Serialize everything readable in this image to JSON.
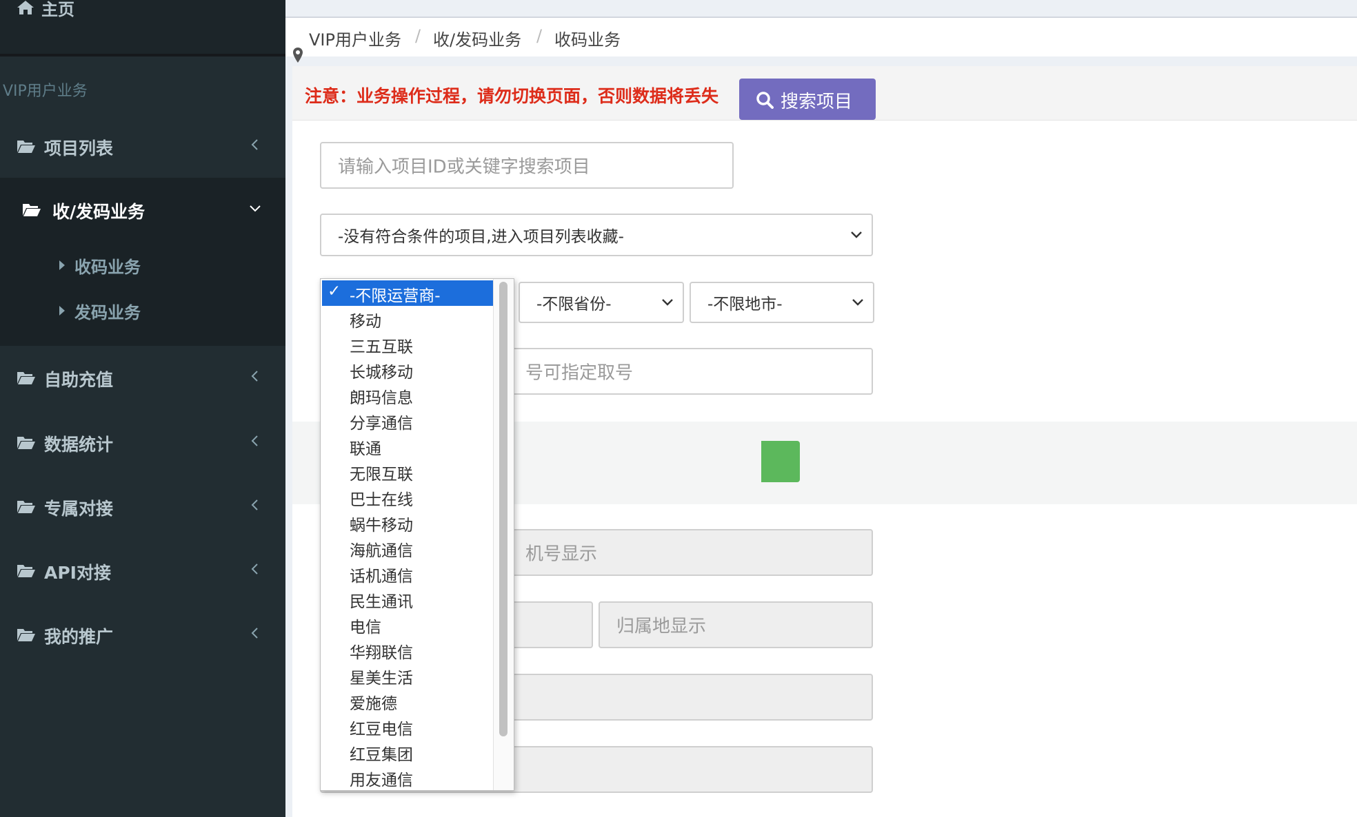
{
  "sidebar": {
    "home": {
      "label": "主页",
      "icon": "home-icon"
    },
    "section_header": "VIP用户业务",
    "items": [
      {
        "label": "项目列表",
        "icon": "folder-open-icon"
      },
      {
        "label": "收/发码业务",
        "icon": "folder-open-icon",
        "expanded": true,
        "children": [
          {
            "label": "收码业务"
          },
          {
            "label": "发码业务"
          }
        ]
      },
      {
        "label": "自助充值",
        "icon": "folder-open-icon"
      },
      {
        "label": "数据统计",
        "icon": "folder-open-icon"
      },
      {
        "label": "专属对接",
        "icon": "folder-open-icon"
      },
      {
        "label": "API对接",
        "icon": "folder-open-icon"
      },
      {
        "label": "我的推广",
        "icon": "folder-open-icon"
      }
    ]
  },
  "breadcrumb": [
    "VIP用户业务",
    "收/发码业务",
    "收码业务"
  ],
  "notice": "注意：业务操作过程，请勿切换页面，否则数据将丢失",
  "search": {
    "placeholder": "请输入项目ID或关键字搜索项目",
    "button_label": "搜索项目"
  },
  "project_select": {
    "value": "-没有符合条件的项目,进入项目列表收藏-"
  },
  "province_select": {
    "value": "-不限省份-"
  },
  "city_select": {
    "value": "-不限地市-"
  },
  "number_field": {
    "placeholder_visible": "号可指定取号"
  },
  "phone_display": {
    "placeholder_visible": "机号显示"
  },
  "location_display": {
    "placeholder": "归属地显示"
  },
  "carrier_dropdown": {
    "selected": "-不限运营商-",
    "check_mark": "✓",
    "options": [
      "-不限运营商-",
      "移动",
      "三五互联",
      "长城移动",
      "朗玛信息",
      "分享通信",
      "联通",
      "无限互联",
      "巴士在线",
      "蜗牛移动",
      "海航通信",
      "话机通信",
      "民生通讯",
      "电信",
      "华翔联信",
      "星美生活",
      "爱施德",
      "红豆电信",
      "红豆集团",
      "用友通信"
    ]
  },
  "colors": {
    "sidebar_bg": "#222d32",
    "accent_purple": "#736cbf",
    "notice_red": "#dd2c1a",
    "success_green": "#5cb85c",
    "selection_blue": "#1c6edc"
  }
}
